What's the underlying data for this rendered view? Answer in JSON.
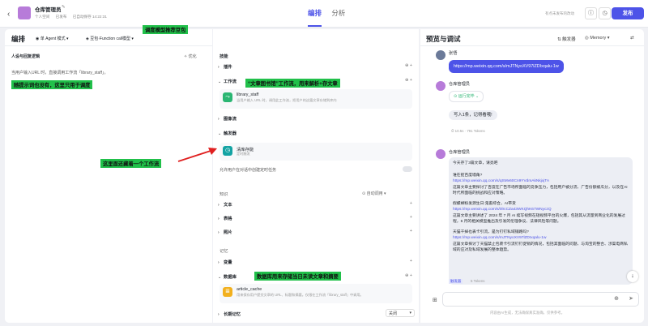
{
  "header": {
    "app_title": "仓库管理员",
    "edit_icon": "edit-icon",
    "personal_space": "个人空间",
    "status": "已发布",
    "saved": "已自动保存 14:22:31",
    "tab_arrange": "编排",
    "tab_analysis": "分析",
    "hint": "有点未发布的改动",
    "publish": "发布"
  },
  "left": {
    "title": "编排",
    "mode": "单 Agent 模式",
    "model": "豆包·Function call模型",
    "section": "人设与回复逻辑",
    "optimize": "优化",
    "prompt": "当用户输入URL 时，直接调用工作流「library_staff」。"
  },
  "middle": {
    "skills": "技能",
    "plugins": "插件",
    "workflow": "工作流",
    "wf_name": "library_staff",
    "wf_desc": "当用户输入 URL 时，调用此工作流，把用户的这篇文章存储到库内",
    "imageflow": "图像流",
    "triggers": "触发器",
    "trigger_name": "清库存能",
    "trigger_type": "定时触发",
    "trigger_allow": "允许用户在对话中创建定时任务",
    "knowledge": "知识",
    "auto_call": "自动调用",
    "text": "文本",
    "table": "表格",
    "photo": "照片",
    "memory": "记忆",
    "variables": "变量",
    "database": "数据库",
    "db_name": "article_cache",
    "db_desc": "用来保存用户提交文章的 URL、标题和摘要。仅限在工作流「library_staff」中调用。",
    "long_memory": "长期记忆",
    "long_memory_state": "关闭"
  },
  "right": {
    "title": "预览与调试",
    "trigger": "触发器",
    "memory": "Memory",
    "user": "张悟",
    "user_link": "https://mp.weixin.qq.com/s/mJTNyoXV97lZDIxqalu-1w",
    "bot": "仓库管理员",
    "running": "运行完毕",
    "reply1": "写入1条，记得看哦!",
    "stat1": "10.5s",
    "stat1_tokens": "791 Tokens",
    "reply2_intro": "今天存了3篇文章，请亮吧",
    "items": [
      {
        "title": "谁在抠百度墙角?",
        "url": "https://mp.weixin.qq.com/s/qSMv60Cn9YVdmAkNkjxjTA",
        "desc": "这篇文章主要探讨了百度在广告市场所面临的竞争压力，包括用户被分流、广告份额被瓜分，以及在AI时代所面临的挑战和应对策略。"
      },
      {
        "title": "假螺蛳粉发源生日:鬼畜综合，AI带货",
        "url": "https://mp.weixin.qq.com/s/0lrcCZa43WKQhK67WNyczQ",
        "desc": "这篇文章主要讲述了 2024 年 7 月 AI 续写视频在短视频平台的火爆，包括其从流量到商业化的发展过程，6 月的相关模型推出及引发的伦理争议、法律风险等问题。"
      },
      {
        "title": "天猫干掉也表卡引流，是为钉钉私域铺路吗?",
        "url": "https://mp.weixin.qq.com/s/mJTNyoXV97lZDIxqalu-1w",
        "desc": "这篇文章探讨了天猫禁止包裹卡引流钉钉促销的情况，包括其面临的问题、与淘宝的整合、涉渠电商私域的应对及私域发展的整体趋势。"
      }
    ],
    "bottom_tag": "触发器",
    "bottom_stat": "5 Tokens",
    "disclaimer": "内容由AI生成，无法确保真实准确，仅供参考。"
  },
  "annotations": {
    "a1": "调度模型推荐豆包",
    "a2": "随提示词也没有，这里只用于调度",
    "a3": "“文章图书馆”工作流，用来解析+存文章",
    "a4": "这里面还藏着一个工作流",
    "a5": "数据库用来存储当日未读文章和摘要"
  }
}
